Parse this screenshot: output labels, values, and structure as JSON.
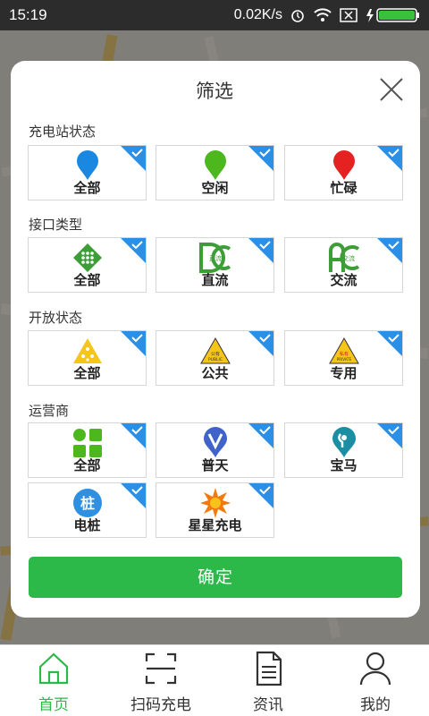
{
  "status_bar": {
    "time": "15:19",
    "network_speed": "0.02K/s",
    "icons": [
      "alarm-icon",
      "wifi-icon",
      "sim-off-icon",
      "battery-charging-icon"
    ]
  },
  "modal": {
    "title": "筛选",
    "close_icon": "close-icon",
    "sections": [
      {
        "title": "充电站状态",
        "options": [
          {
            "label": "全部",
            "icon": "pin-blue-icon",
            "selected": true
          },
          {
            "label": "空闲",
            "icon": "pin-green-icon",
            "selected": true
          },
          {
            "label": "忙碌",
            "icon": "pin-red-icon",
            "selected": true
          }
        ]
      },
      {
        "title": "接口类型",
        "options": [
          {
            "label": "全部",
            "icon": "connector-all-icon",
            "selected": true
          },
          {
            "label": "直流",
            "icon": "dc-icon",
            "icon_text": "直流",
            "selected": true
          },
          {
            "label": "交流",
            "icon": "ac-icon",
            "icon_text": "交流",
            "selected": true
          }
        ]
      },
      {
        "title": "开放状态",
        "options": [
          {
            "label": "全部",
            "icon": "open-all-icon",
            "selected": true
          },
          {
            "label": "公共",
            "icon": "public-sign-icon",
            "icon_text": "公有 PUBLIC",
            "selected": true
          },
          {
            "label": "专用",
            "icon": "private-sign-icon",
            "icon_text": "私有 PRIVATE",
            "selected": true
          }
        ]
      },
      {
        "title": "运营商",
        "options": [
          {
            "label": "全部",
            "icon": "operator-all-icon",
            "selected": true
          },
          {
            "label": "普天",
            "icon": "putian-logo-icon",
            "selected": true
          },
          {
            "label": "宝马",
            "icon": "bmw-pin-icon",
            "selected": true
          },
          {
            "label": "电桩",
            "icon": "dianzhuang-logo-icon",
            "icon_text": "桩",
            "selected": true
          },
          {
            "label": "星星充电",
            "icon": "xingxing-logo-icon",
            "selected": true
          }
        ]
      }
    ],
    "confirm_label": "确定"
  },
  "bottom_nav": [
    {
      "label": "首页",
      "icon": "home-icon",
      "active": true
    },
    {
      "label": "扫码充电",
      "icon": "scan-icon",
      "active": false
    },
    {
      "label": "资讯",
      "icon": "news-icon",
      "active": false
    },
    {
      "label": "我的",
      "icon": "profile-icon",
      "active": false
    }
  ],
  "colors": {
    "accent": "#2db84a",
    "check_blue": "#2b8fe6",
    "pin_blue": "#1a87e0",
    "pin_green": "#4cb81e",
    "pin_red": "#e52222",
    "sign_yellow": "#f5c518"
  }
}
